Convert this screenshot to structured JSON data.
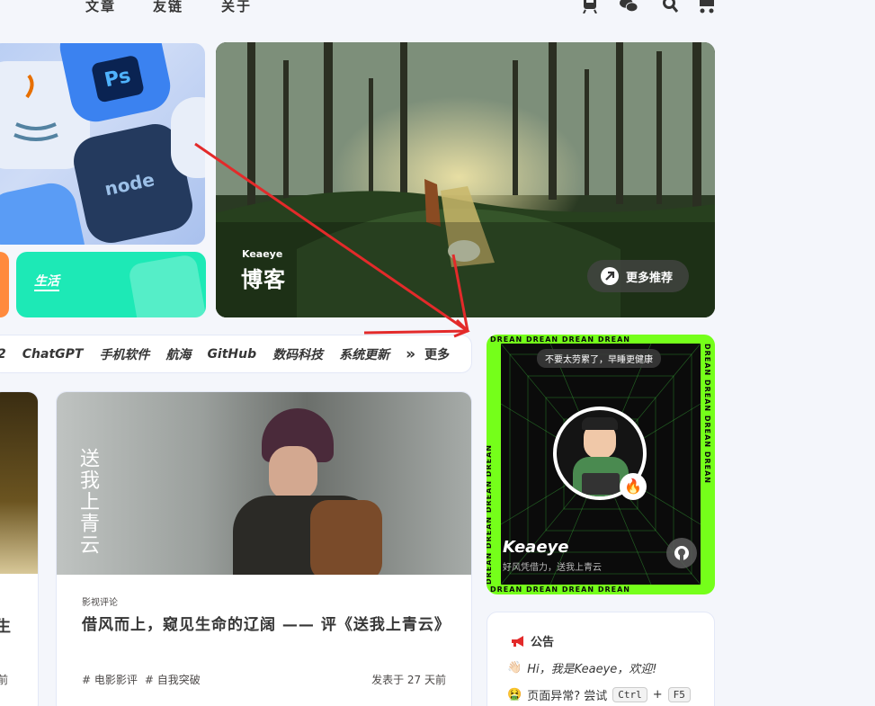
{
  "nav": {
    "items": [
      "文章",
      "友链",
      "关于"
    ]
  },
  "categories": {
    "life_label": "生活"
  },
  "banner": {
    "subtitle": "Keaeye",
    "title": "博客",
    "more_label": "更多推荐"
  },
  "tags": {
    "items": [
      "2",
      "ChatGPT",
      "手机软件",
      "航海",
      "GitHub",
      "数码科技",
      "系统更新"
    ],
    "more_label": "更多",
    "more_icon": "»"
  },
  "left_card": {
    "title_fragment": "生",
    "date_fragment": "前"
  },
  "post": {
    "category": "影视评论",
    "title": "借风而上，窥见生命的辽阔 —— 评《送我上青云》",
    "tags": [
      "# 电影影评",
      "# 自我突破"
    ],
    "date": "发表于 27 天前",
    "poster_text": "送我上青云"
  },
  "author": {
    "border_text": "DREAN DREAN DREAN DREAN",
    "pill": "不要太劳累了，早睡更健康",
    "name": "Keaeye",
    "desc": "好风凭借力，送我上青云",
    "badge_emoji": "🔥"
  },
  "notice": {
    "title": "公告",
    "line1": "Hi，我是Keaeye，欢迎!",
    "line1_emoji": "👋🏻",
    "line2": "页面异常? 尝试",
    "line2_emoji": "🤮",
    "key1": "Ctrl",
    "plus": "+",
    "key2": "F5"
  },
  "colors": {
    "accent_green": "#75ff1a",
    "life_card": "#1de9b6",
    "orange_card": "#ff8a3d",
    "arrow_red": "#e32a2a"
  }
}
